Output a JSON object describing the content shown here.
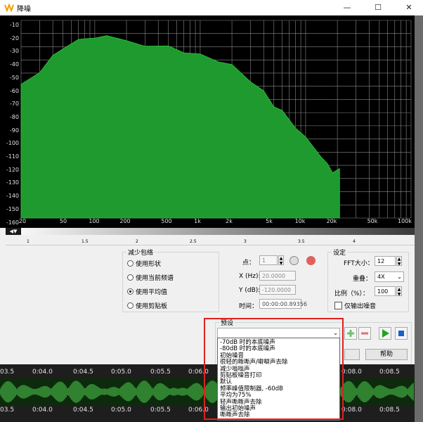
{
  "window": {
    "title": "降噪",
    "controls": {
      "minimize": "—",
      "maximize": "☐",
      "close": "✕"
    }
  },
  "spectrum": {
    "y_ticks": [
      "-10",
      "-20",
      "-30",
      "-40",
      "-50",
      "-60",
      "-70",
      "-80",
      "-90",
      "-100",
      "-110",
      "-120",
      "-130",
      "-140",
      "-150",
      "-160"
    ],
    "x_ticks": [
      "20",
      "50",
      "100",
      "200",
      "500",
      "1k",
      "2k",
      "5k",
      "10k",
      "20k",
      "50k",
      "100k"
    ],
    "scale_ticks": [
      "1",
      "1.5",
      "2",
      "2.5",
      "3",
      "3.5",
      "4"
    ],
    "fill_color": "#1f9a2e",
    "grid_color": "#8a8a8a"
  },
  "reduce_envelope": {
    "label": "减少包络",
    "options": [
      {
        "label": "使用形状",
        "selected": false
      },
      {
        "label": "使用当前频谱",
        "selected": false
      },
      {
        "label": "使用平均值",
        "selected": true
      },
      {
        "label": "使用剪贴板",
        "selected": false
      }
    ]
  },
  "point": {
    "point_label": "点：",
    "point_value": "1",
    "x_label": "X (Hz):",
    "x_value": "20.0000",
    "y_label": "Y (dB):",
    "y_value": "-120.0000",
    "time_label": "时间：",
    "time_value": "00:00:00.89356"
  },
  "settings": {
    "label": "设定",
    "fft_label": "FFT大小：",
    "fft_value": "12",
    "overlap_label": "重叠：",
    "overlap_value": "4X",
    "ratio_label": "比例（%）：",
    "ratio_value": "100",
    "output_noise_label": "仅输出噪音"
  },
  "preset": {
    "label": "预设",
    "selected": "",
    "help_label": "帮助",
    "items": [
      "-70dB 时的本底噪声",
      "-80dB 时的本底噪声",
      "初始噪音",
      "很轻的嘶嘶声/噼噼声去除",
      "减少嗡嗡声",
      "剪贴板噪音打印",
      "默认",
      "频率峰值限制器, -60dB",
      "平均为75%",
      "轻声嘶嘶声去除",
      "输出初始噪声",
      "嘶嘶声去除"
    ]
  },
  "timeline": {
    "labels": [
      "03.5",
      "0:04.0",
      "0:04.5",
      "0:05.0",
      "0:05.5",
      "0:06.0",
      "0:08.0",
      "0:08.5"
    ]
  }
}
